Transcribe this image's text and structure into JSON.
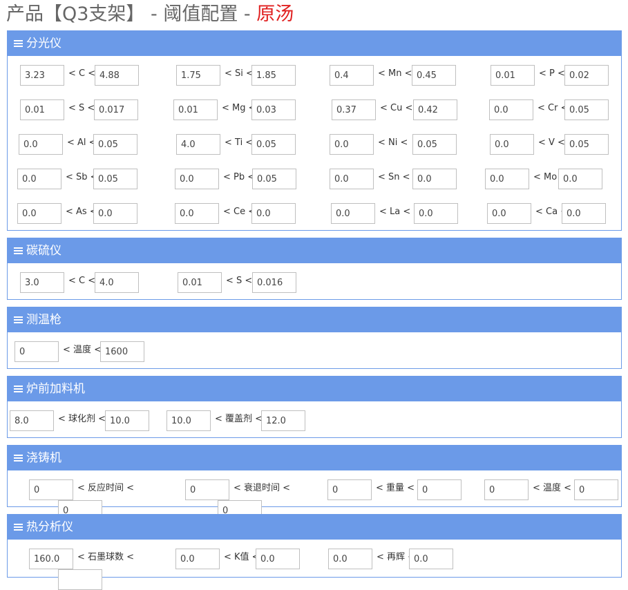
{
  "title": {
    "main": "产品【Q3支架】 - 阈值配置 - ",
    "highlight": "原汤"
  },
  "accent_color": "#6b9ae8",
  "icon": "hamburger-menu-icon",
  "sections": [
    {
      "id": "spectrometer",
      "title": "分光仪",
      "rows": [
        [
          {
            "label": "< C <",
            "min": "3.23",
            "max": "4.88"
          },
          {
            "label": "< Si <",
            "min": "1.75",
            "max": "1.85"
          },
          {
            "label": "< Mn <",
            "min": "0.4",
            "max": "0.45"
          },
          {
            "label": "< P <",
            "min": "0.01",
            "max": "0.02"
          }
        ],
        [
          {
            "label": "< S <",
            "min": "0.01",
            "max": "0.017"
          },
          {
            "label": "< Mg <",
            "min": "0.01",
            "max": "0.03"
          },
          {
            "label": "< Cu <",
            "min": "0.37",
            "max": "0.42"
          },
          {
            "label": "< Cr <",
            "min": "0.0",
            "max": "0.05"
          }
        ],
        [
          {
            "label": "< Al <",
            "min": "0.0",
            "max": "0.05"
          },
          {
            "label": "< Ti <",
            "min": "4.0",
            "max": "0.05"
          },
          {
            "label": "< Ni <",
            "min": "0.0",
            "max": "0.05"
          },
          {
            "label": "< V <",
            "min": "0.0",
            "max": "0.05"
          }
        ],
        [
          {
            "label": "< Sb <",
            "min": "0.0",
            "max": "0.05"
          },
          {
            "label": "< Pb <",
            "min": "0.0",
            "max": "0.05"
          },
          {
            "label": "< Sn <",
            "min": "0.0",
            "max": "0.0"
          },
          {
            "label": "< Mo <",
            "min": "0.0",
            "max": "0.0"
          }
        ],
        [
          {
            "label": "< As <",
            "min": "0.0",
            "max": "0.0"
          },
          {
            "label": "< Ce <",
            "min": "0.0",
            "max": "0.0"
          },
          {
            "label": "< La <",
            "min": "0.0",
            "max": "0.0"
          },
          {
            "label": "< Ca <",
            "min": "0.0",
            "max": "0.0"
          }
        ]
      ]
    },
    {
      "id": "carbon-sulfur",
      "title": "碳硫仪",
      "rows": [
        [
          {
            "label": "< C <",
            "min": "3.0",
            "max": "4.0"
          },
          {
            "label": "< S <",
            "min": "0.01",
            "max": "0.016"
          }
        ]
      ]
    },
    {
      "id": "thermometer",
      "title": "测温枪",
      "rows": [
        [
          {
            "label": "< 温度 <",
            "min": "0",
            "max": "1600"
          }
        ]
      ]
    },
    {
      "id": "pre-furnace",
      "title": "炉前加料机",
      "rows": [
        [
          {
            "label": "< 球化剂 <",
            "min": "8.0",
            "max": "10.0"
          },
          {
            "label": "< 覆盖剂 <",
            "min": "10.0",
            "max": "12.0"
          }
        ]
      ]
    },
    {
      "id": "pouring",
      "title": "浇铸机",
      "rows": [
        [
          {
            "label": "< 反应时间 <",
            "min": "0",
            "max": "0"
          },
          {
            "label": "< 衰退时间 <",
            "min": "0",
            "max": "0"
          },
          {
            "label": "< 重量 <",
            "min": "0",
            "max": "0"
          },
          {
            "label": "< 温度 <",
            "min": "0",
            "max": "0"
          }
        ]
      ]
    },
    {
      "id": "thermal-analyzer",
      "title": "热分析仪",
      "rows": [
        [
          {
            "label": "< 石墨球数 <",
            "min": "160.0",
            "max": ""
          },
          {
            "label": "< K值 <",
            "min": "0.0",
            "max": "0.0"
          },
          {
            "label": "< 再辉 <",
            "min": "0.0",
            "max": "0.0"
          }
        ]
      ]
    }
  ]
}
